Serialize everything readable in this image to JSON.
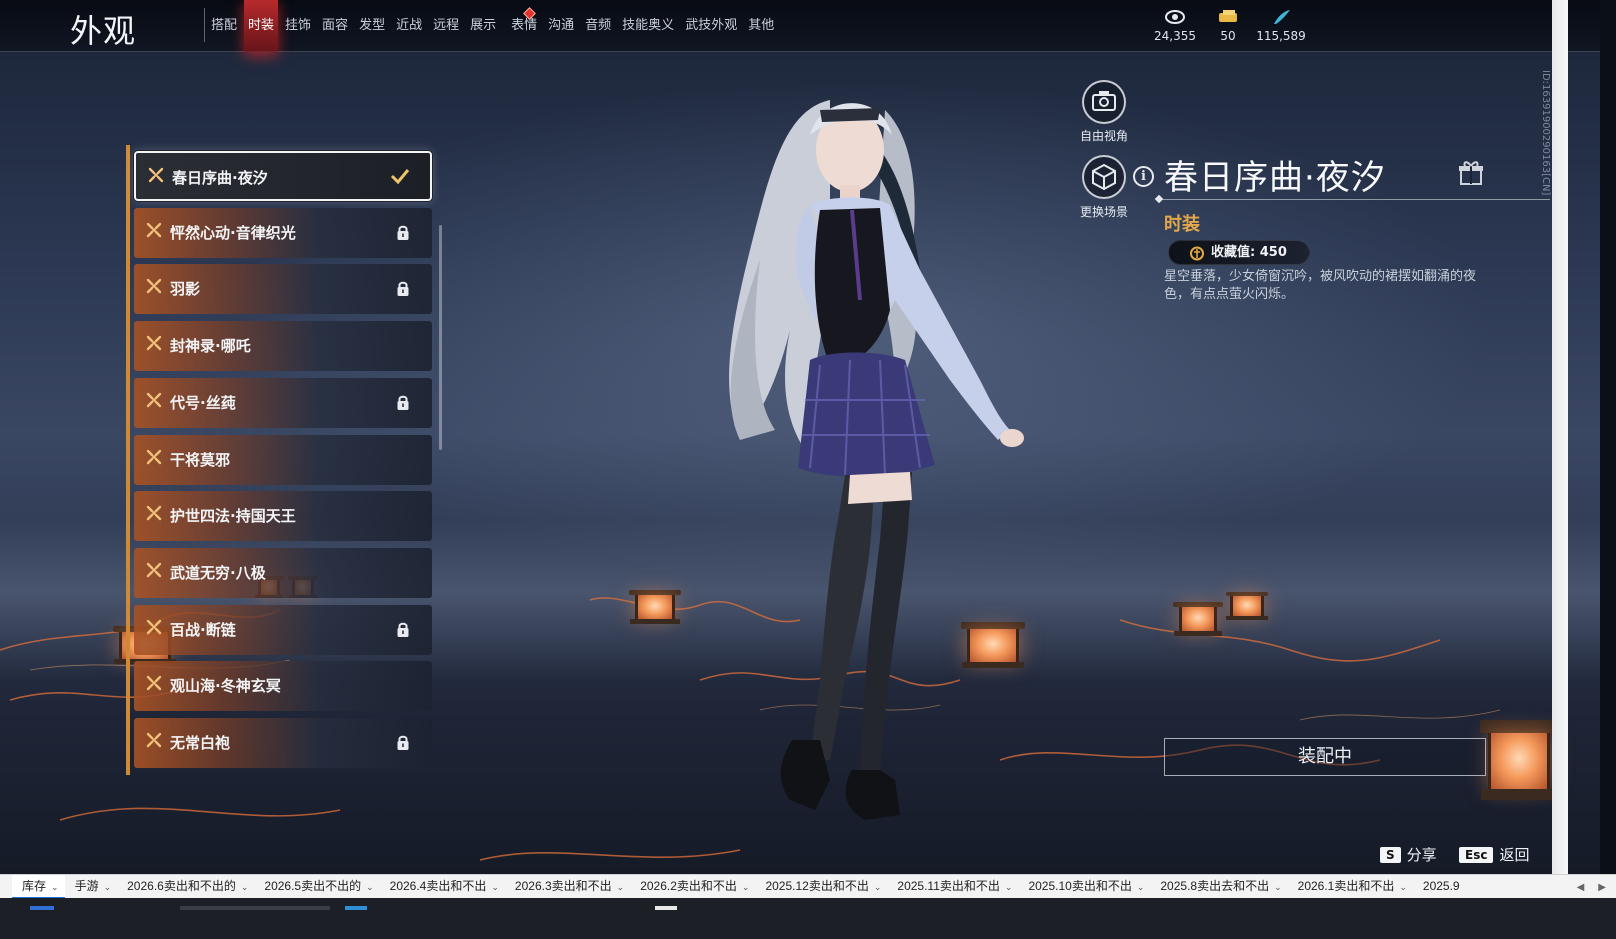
{
  "header": {
    "title": "外观",
    "tabs": [
      {
        "label": "搭配",
        "active": false
      },
      {
        "label": "时装",
        "active": true
      },
      {
        "label": "挂饰",
        "active": false
      },
      {
        "label": "面容",
        "active": false
      },
      {
        "label": "发型",
        "active": false
      },
      {
        "label": "近战",
        "active": false
      },
      {
        "label": "远程",
        "active": false
      },
      {
        "label": "展示",
        "active": false
      },
      {
        "label": "表情",
        "active": false,
        "notice": true
      },
      {
        "label": "沟通",
        "active": false
      },
      {
        "label": "音频",
        "active": false
      },
      {
        "label": "技能奥义",
        "active": false
      },
      {
        "label": "武技外观",
        "active": false
      },
      {
        "label": "其他",
        "active": false
      }
    ],
    "currencies": [
      {
        "icon": "coin-eye-icon",
        "value": "24,355"
      },
      {
        "icon": "ticket-icon",
        "value": "50"
      },
      {
        "icon": "feather-icon",
        "value": "115,589"
      }
    ]
  },
  "side_id": "ID:1639190029016​3[CN]",
  "outfits": [
    {
      "name": "春日序曲·夜汐",
      "status": "equipped"
    },
    {
      "name": "怦然心动·音律织光",
      "status": "locked"
    },
    {
      "name": "羽影",
      "status": "locked"
    },
    {
      "name": "封神录·哪吒",
      "status": "owned"
    },
    {
      "name": "代号·丝莼",
      "status": "locked"
    },
    {
      "name": "干将莫邪",
      "status": "owned"
    },
    {
      "name": "护世四法·持国天王",
      "status": "owned"
    },
    {
      "name": "武道无穷·八极",
      "status": "owned"
    },
    {
      "name": "百战·断链",
      "status": "locked"
    },
    {
      "name": "观山海·冬神玄冥",
      "status": "owned"
    },
    {
      "name": "无常白袍",
      "status": "locked"
    }
  ],
  "actions": {
    "free_view": "自由视角",
    "change_scene": "更换场景"
  },
  "detail": {
    "title": "春日序曲·夜汐",
    "category": "时装",
    "collection_label": "收藏值: 450",
    "description": "星空垂落，少女倚窗沉吟，被风吹动的裙摆如翻涌的夜色，有点点萤火闪烁。",
    "equip_button": "装配中"
  },
  "hints": {
    "share_key": "S",
    "share_label": "分享",
    "back_key": "Esc",
    "back_label": "返回"
  },
  "sheet_tabs": [
    {
      "label": "库存",
      "active": true
    },
    {
      "label": "手游",
      "active": false
    },
    {
      "label": "2026.6卖出和不出的",
      "active": false
    },
    {
      "label": "2026.5卖出不出的",
      "active": false
    },
    {
      "label": "2026.4卖出和不出",
      "active": false
    },
    {
      "label": "2026.3卖出和不出",
      "active": false
    },
    {
      "label": "2026.2卖出和不出",
      "active": false
    },
    {
      "label": "2025.12卖出和不出",
      "active": false
    },
    {
      "label": "2025.11卖出和不出",
      "active": false
    },
    {
      "label": "2025.10卖出和不出",
      "active": false
    },
    {
      "label": "2025.8卖出去和不出",
      "active": false
    },
    {
      "label": "2026.1卖出和不出",
      "active": false
    },
    {
      "label": "2025.9",
      "active": false
    }
  ],
  "colors": {
    "active_tab": "#d63030",
    "accent_orange": "#d08a36",
    "category_gold": "#e4a84a",
    "panel_dark": "#1c1f26"
  }
}
